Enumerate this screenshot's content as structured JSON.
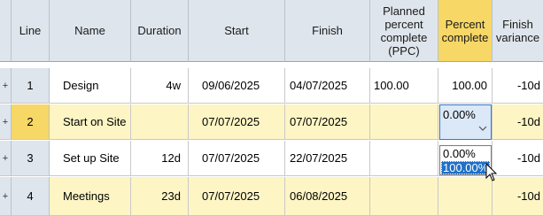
{
  "columns": {
    "line": "Line",
    "name": "Name",
    "duration": "Duration",
    "start": "Start",
    "finish": "Finish",
    "ppc_line1": "Planned",
    "ppc_line2": "percent",
    "ppc_line3": "complete",
    "ppc_line4": "(PPC)",
    "pct_line1": "Percent",
    "pct_line2": "complete",
    "fv_line1": "Finish",
    "fv_line2": "variance"
  },
  "rows": [
    {
      "expander": "+",
      "line": "1",
      "name": "Design",
      "duration": "4w",
      "start": "09/06/2025",
      "finish": "04/07/2025",
      "ppc": "100.00",
      "percent": "100.00",
      "finish_variance": "-10d"
    },
    {
      "expander": "+",
      "line": "2",
      "name": "Start on Site",
      "duration": "",
      "start": "07/07/2025",
      "finish": "07/07/2025",
      "ppc": "",
      "percent": "0.00%",
      "finish_variance": "-10d"
    },
    {
      "expander": "+",
      "line": "3",
      "name": "Set up Site",
      "duration": "12d",
      "start": "07/07/2025",
      "finish": "22/07/2025",
      "ppc": "",
      "percent": "",
      "finish_variance": "-10d"
    },
    {
      "expander": "+",
      "line": "4",
      "name": "Meetings",
      "duration": "23d",
      "start": "07/07/2025",
      "finish": "06/08/2025",
      "ppc": "",
      "percent": "",
      "finish_variance": "-10d"
    }
  ],
  "dropdown": {
    "options": [
      "0.00%",
      "100.00%"
    ],
    "selected": "100.00%"
  },
  "colors": {
    "header_bg": "#dfe5ec",
    "highlight": "#f7d766",
    "row_yellow": "#fdf5c4",
    "selection": "#1e70c8"
  }
}
